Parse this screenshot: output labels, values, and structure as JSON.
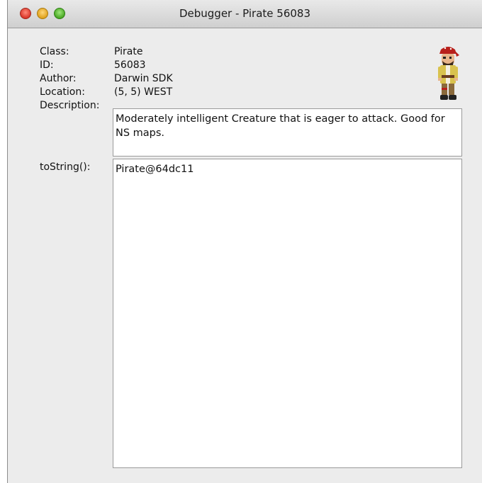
{
  "window": {
    "title": "Debugger - Pirate 56083"
  },
  "fields": {
    "class_label": "Class:",
    "class_value": "Pirate",
    "id_label": "ID:",
    "id_value": "56083",
    "author_label": "Author:",
    "author_value": "Darwin SDK",
    "location_label": "Location:",
    "location_value": "(5, 5) WEST",
    "description_label": "Description:",
    "description_value": "Moderately intelligent Creature that is eager to attack. Good for NS maps.",
    "tostring_label": "toString():",
    "tostring_value": "Pirate@64dc11"
  },
  "icons": {
    "avatar": "pirate-sprite-icon",
    "close": "close-traffic-light-icon",
    "minimize": "minimize-traffic-light-icon",
    "maximize": "zoom-traffic-light-icon"
  },
  "colors": {
    "close": "#d9362a",
    "minimize": "#e0a21d",
    "maximize": "#4aa824",
    "window_bg": "#ececec"
  }
}
